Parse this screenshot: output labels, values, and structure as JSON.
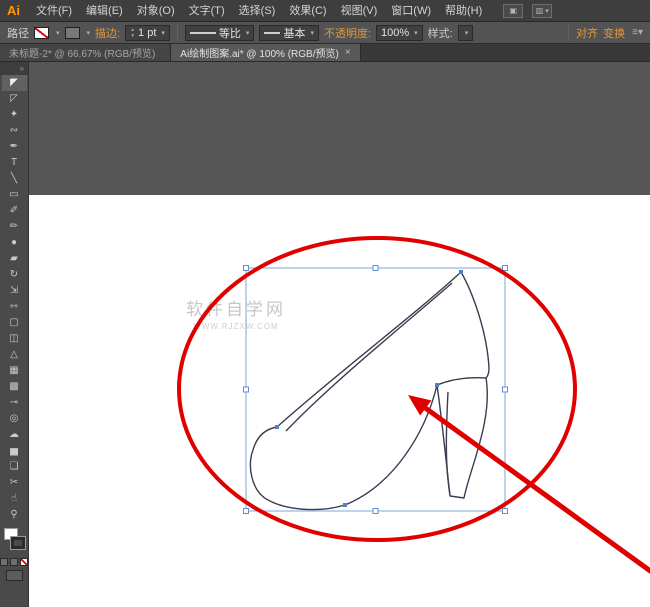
{
  "menubar": {
    "logo": "Ai",
    "items": [
      {
        "name": "menu-file",
        "label": "文件(F)"
      },
      {
        "name": "menu-edit",
        "label": "编辑(E)"
      },
      {
        "name": "menu-object",
        "label": "对象(O)"
      },
      {
        "name": "menu-type",
        "label": "文字(T)"
      },
      {
        "name": "menu-select",
        "label": "选择(S)"
      },
      {
        "name": "menu-effect",
        "label": "效果(C)"
      },
      {
        "name": "menu-view",
        "label": "视图(V)"
      },
      {
        "name": "menu-window",
        "label": "窗口(W)"
      },
      {
        "name": "menu-help",
        "label": "帮助(H)"
      }
    ],
    "right_icons": [
      "arrange-documents-icon",
      "workspace-switcher-icon"
    ]
  },
  "control_bar": {
    "context_label": "路径",
    "stroke_link": "描边:",
    "stroke_weight": "1 pt",
    "profile_value": "等比",
    "brush_value": "基本",
    "opacity_link": "不透明度:",
    "opacity_value": "100%",
    "style_label": "样式:",
    "align_link": "对齐",
    "transform_link": "变换"
  },
  "tabs": [
    {
      "name": "tab-untitled-2",
      "label": "未标题-2* @ 66.67% (RGB/预览)",
      "close": "",
      "active": false
    },
    {
      "name": "tab-ai-pattern",
      "label": "Ai绘制图案.ai* @ 100% (RGB/预览)",
      "close": "×",
      "active": true
    }
  ],
  "toolbar": {
    "collapse_glyph": "»",
    "tools": [
      {
        "name": "selection-tool",
        "glyph": "◤",
        "active": true
      },
      {
        "name": "direct-selection-tool",
        "glyph": "◸"
      },
      {
        "name": "magic-wand-tool",
        "glyph": "✦"
      },
      {
        "name": "lasso-tool",
        "glyph": "∾"
      },
      {
        "name": "pen-tool",
        "glyph": "✒"
      },
      {
        "name": "type-tool",
        "glyph": "T"
      },
      {
        "name": "line-segment-tool",
        "glyph": "╲"
      },
      {
        "name": "rectangle-tool",
        "glyph": "▭"
      },
      {
        "name": "paintbrush-tool",
        "glyph": "✐"
      },
      {
        "name": "pencil-tool",
        "glyph": "✏"
      },
      {
        "name": "blob-brush-tool",
        "glyph": "●"
      },
      {
        "name": "eraser-tool",
        "glyph": "▰"
      },
      {
        "name": "rotate-tool",
        "glyph": "↻"
      },
      {
        "name": "scale-tool",
        "glyph": "⇲"
      },
      {
        "name": "width-tool",
        "glyph": "⇿"
      },
      {
        "name": "free-transform-tool",
        "glyph": "▢"
      },
      {
        "name": "shape-builder-tool",
        "glyph": "◫"
      },
      {
        "name": "perspective-grid-tool",
        "glyph": "△"
      },
      {
        "name": "mesh-tool",
        "glyph": "▦"
      },
      {
        "name": "gradient-tool",
        "glyph": "▩"
      },
      {
        "name": "eyedropper-tool",
        "glyph": "⊸"
      },
      {
        "name": "blend-tool",
        "glyph": "◎"
      },
      {
        "name": "symbol-sprayer-tool",
        "glyph": "☁"
      },
      {
        "name": "column-graph-tool",
        "glyph": "▅"
      },
      {
        "name": "artboard-tool",
        "glyph": "❏"
      },
      {
        "name": "slice-tool",
        "glyph": "✂"
      },
      {
        "name": "hand-tool",
        "glyph": "☝"
      },
      {
        "name": "zoom-tool",
        "glyph": "⚲"
      }
    ],
    "bottom_icons": [
      "fill-swatch",
      "stroke-swatch",
      "color-button",
      "gradient-button",
      "none-button",
      "screen-mode-button"
    ]
  },
  "canvas": {
    "watermark_line1": "软件自学网",
    "watermark_line2": "WWW.RJZXW.COM",
    "artwork": "high-heel-shoe-outline"
  },
  "colors": {
    "logo_orange": "#ff9a00",
    "accent_orange": "#e2973b",
    "annotation_red": "#e00000",
    "selection_blue": "#7ea6dc"
  }
}
